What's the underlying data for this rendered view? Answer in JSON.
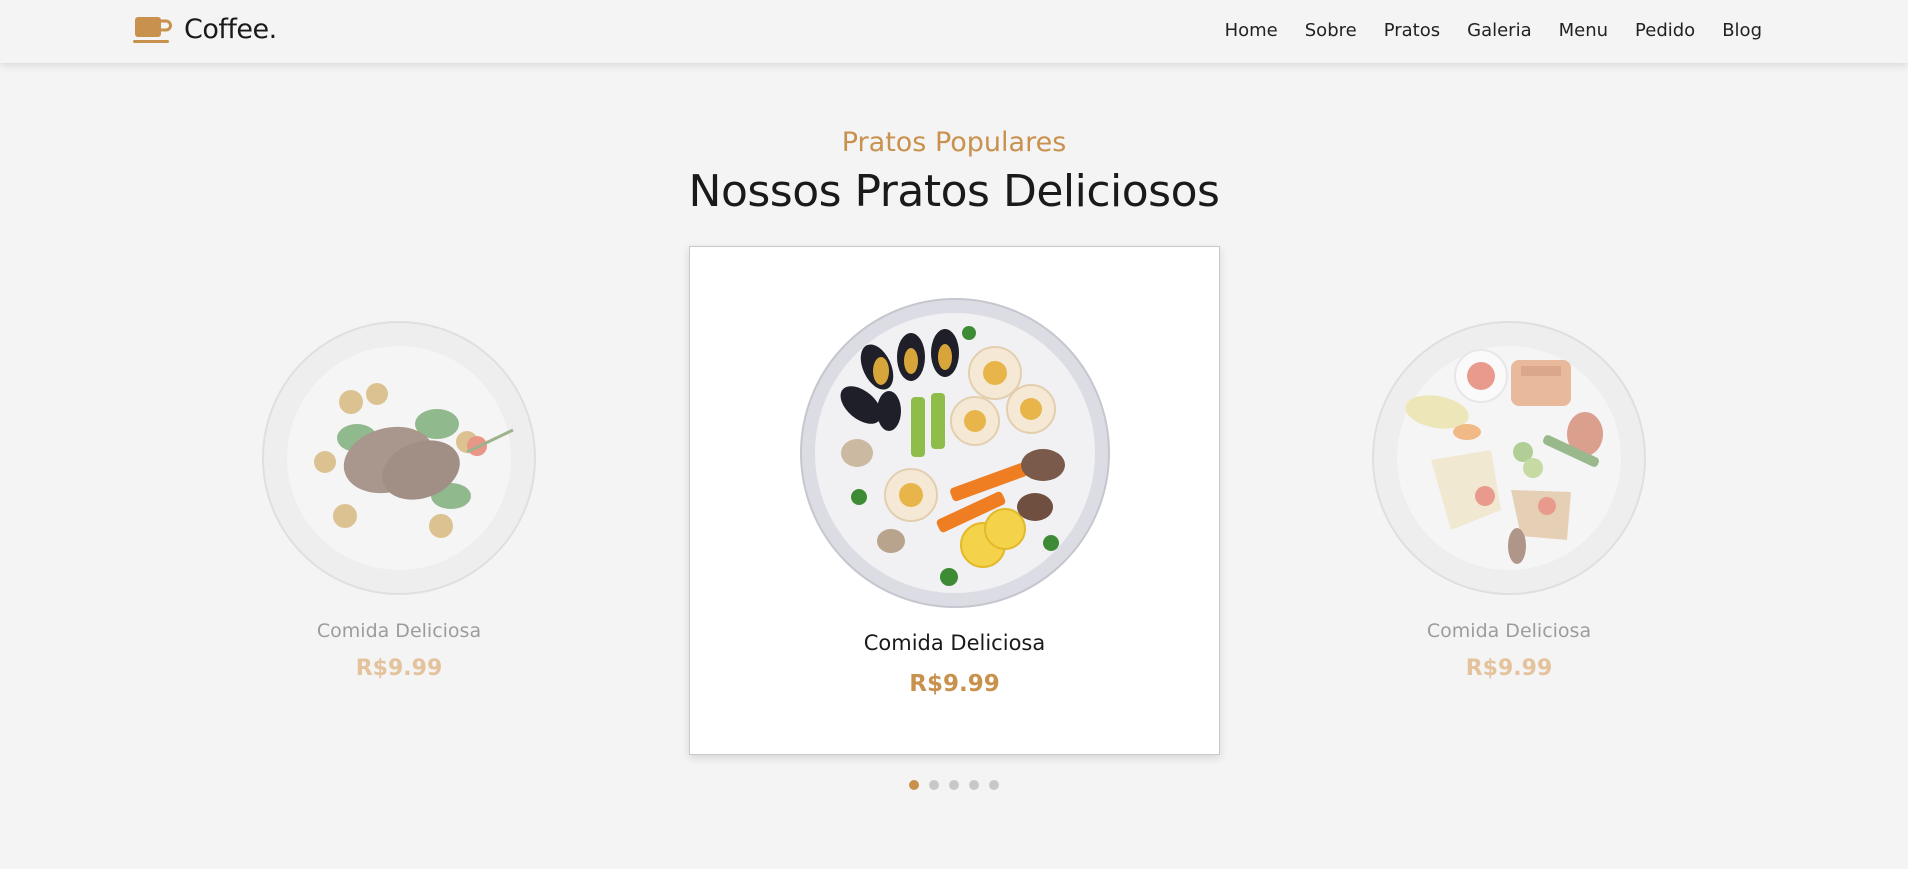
{
  "brand": {
    "name": "Coffee.",
    "icon": "coffee-cup-icon",
    "accent": "#c9914e"
  },
  "nav": {
    "items": [
      {
        "label": "Home"
      },
      {
        "label": "Sobre"
      },
      {
        "label": "Pratos"
      },
      {
        "label": "Galeria"
      },
      {
        "label": "Menu"
      },
      {
        "label": "Pedido"
      },
      {
        "label": "Blog"
      }
    ]
  },
  "section": {
    "subtitle": "Pratos Populares",
    "title": "Nossos Pratos Deliciosos"
  },
  "carousel": {
    "cards": [
      {
        "name": "Comida Deliciosa",
        "price": "R$9.99",
        "image": "steak-potatoes-plate"
      },
      {
        "name": "Comida Deliciosa",
        "price": "R$9.99",
        "image": "seafood-platter-plate"
      },
      {
        "name": "Comida Deliciosa",
        "price": "R$9.99",
        "image": "mixed-grill-plate"
      }
    ],
    "dots_total": 5,
    "active_dot": 1
  }
}
